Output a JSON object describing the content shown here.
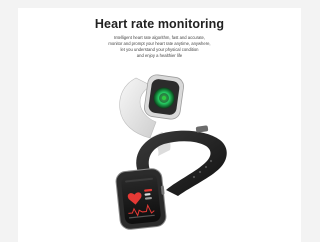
{
  "product": {
    "title": "Heart rate monitoring",
    "description_lines": [
      "Intelligent heart rate algorithm, fast and accurate,",
      "monitor and prompt your heart rate anytime, anywhere,",
      "let you understand your physical condition",
      "and enjoy a healthier life"
    ]
  },
  "watch_screen": {
    "heart_rate_value": "",
    "accent_color": "#e53935",
    "sensor_color": "#2ecc40"
  },
  "colors": {
    "band_white": "#e8e8e8",
    "band_black": "#1e1e1e",
    "heart_red": "#e53935",
    "sensor_green": "#22c55e"
  }
}
